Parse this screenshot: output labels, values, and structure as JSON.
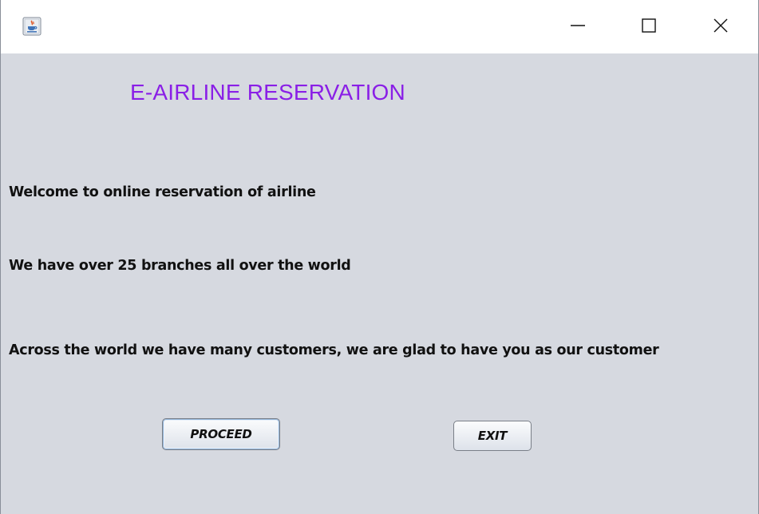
{
  "window": {
    "icon": "java-cup-icon",
    "controls": {
      "minimize": "minimize-icon",
      "maximize": "maximize-icon",
      "close": "close-icon"
    }
  },
  "main": {
    "heading": "E-AIRLINE RESERVATION",
    "heading_color": "#8a1fe6",
    "lines": [
      "Welcome to online reservation of airline",
      "We have over 25 branches all over the world",
      "Across the world we have many customers, we are glad to have you as our customer"
    ],
    "buttons": {
      "proceed": "PROCEED",
      "exit": "EXIT"
    }
  },
  "colors": {
    "background": "#d6d9e0",
    "titlebar": "#ffffff",
    "text": "#111111"
  }
}
